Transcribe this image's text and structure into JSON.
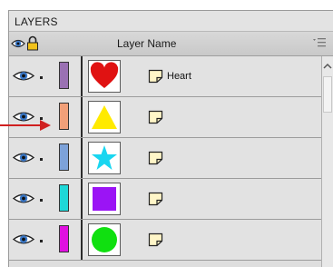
{
  "panel": {
    "title": "LAYERS",
    "header": {
      "eye_icon": "eye-icon",
      "lock_icon": "lock-icon",
      "column_label": "Layer Name",
      "menu_icon": "panel-menu-icon"
    }
  },
  "layers": [
    {
      "name": "Heart",
      "outline_color": "#9a71b3",
      "shape": "heart",
      "shape_color": "#e01212"
    },
    {
      "name": "",
      "outline_color": "#f2a079",
      "shape": "triangle",
      "shape_color": "#ffea00"
    },
    {
      "name": "",
      "outline_color": "#7da2d9",
      "shape": "star",
      "shape_color": "#19d6f0"
    },
    {
      "name": "",
      "outline_color": "#1fd8d8",
      "shape": "square",
      "shape_color": "#9b14f5"
    },
    {
      "name": "",
      "outline_color": "#e010e0",
      "shape": "circle",
      "shape_color": "#10e010"
    }
  ],
  "annotation_arrow_color": "#d02020"
}
